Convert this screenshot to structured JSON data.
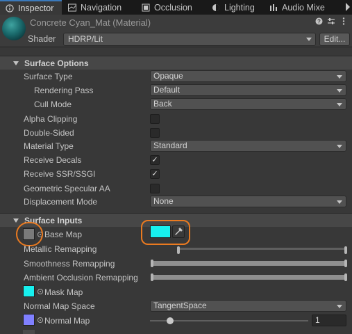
{
  "tabs": [
    {
      "label": "Inspector",
      "icon": "inspector-icon",
      "active": true
    },
    {
      "label": "Navigation",
      "icon": "navigation-icon",
      "active": false
    },
    {
      "label": "Occlusion",
      "icon": "occlusion-icon",
      "active": false
    },
    {
      "label": "Lighting",
      "icon": "lighting-icon",
      "active": false
    },
    {
      "label": "Audio Mixe",
      "icon": "audio-mixer-icon",
      "active": false
    }
  ],
  "header": {
    "title": "Concrete Cyan_Mat (Material)",
    "shader_label": "Shader",
    "shader_value": "HDRP/Lit",
    "edit_label": "Edit..."
  },
  "surface_options": {
    "title": "Surface Options",
    "surface_type": {
      "label": "Surface Type",
      "value": "Opaque"
    },
    "rendering_pass": {
      "label": "Rendering Pass",
      "value": "Default"
    },
    "cull_mode": {
      "label": "Cull Mode",
      "value": "Back"
    },
    "alpha_clipping": {
      "label": "Alpha Clipping",
      "checked": false
    },
    "double_sided": {
      "label": "Double-Sided",
      "checked": false
    },
    "material_type": {
      "label": "Material Type",
      "value": "Standard"
    },
    "receive_decals": {
      "label": "Receive Decals",
      "checked": true
    },
    "receive_ssr": {
      "label": "Receive SSR/SSGI",
      "checked": true
    },
    "geometric_specular_aa": {
      "label": "Geometric Specular AA",
      "checked": false
    },
    "displacement_mode": {
      "label": "Displacement Mode",
      "value": "None"
    }
  },
  "surface_inputs": {
    "title": "Surface Inputs",
    "base_map": {
      "label": "Base Map",
      "color": "#17f0ee"
    },
    "metallic_remapping": {
      "label": "Metallic Remapping"
    },
    "smoothness_remapping": {
      "label": "Smoothness Remapping"
    },
    "ao_remapping": {
      "label": "Ambient Occlusion Remapping"
    },
    "mask_map": {
      "label": "Mask Map"
    },
    "normal_map_space": {
      "label": "Normal Map Space",
      "value": "TangentSpace"
    },
    "normal_map": {
      "label": "Normal Map",
      "strength": "1"
    }
  },
  "check_glyph": "✓",
  "colors": {
    "accent_tab": "#3a79bb",
    "callout": "#ea7a20",
    "mask_thumb": "#17f0ee",
    "normal_thumb": "#8080ff"
  }
}
